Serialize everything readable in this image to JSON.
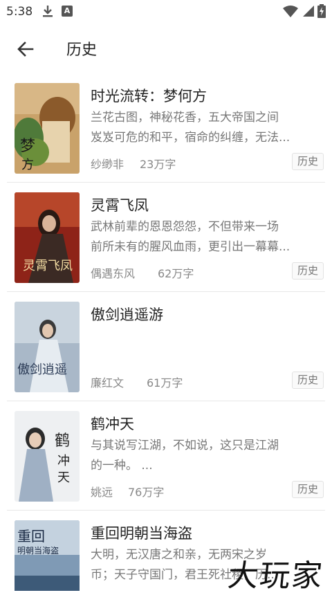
{
  "status": {
    "time": "5:38",
    "a_badge": "A"
  },
  "appbar": {
    "title": "历史"
  },
  "books": [
    {
      "title": "时光流转：梦何方",
      "desc": [
        "兰花古图，神秘花香，五大帝国之间",
        "岌岌可危的和平，宿命的纠缠，无法..."
      ],
      "author": "纱缈非",
      "words": "23万字",
      "tag": "历史"
    },
    {
      "title": "灵霄飞凤",
      "desc": [
        "武林前辈的恩恩怨怨，不但带来一场",
        "前所未有的腥风血雨，更引出一幕幕..."
      ],
      "author": "偶遇东风",
      "words": "62万字",
      "tag": "历史"
    },
    {
      "title": "傲剑逍遥游",
      "desc": [
        "",
        ""
      ],
      "author": "廉红文",
      "words": "61万字",
      "tag": "历史"
    },
    {
      "title": "鹤冲天",
      "desc": [
        "与其说写江湖，不如说，这只是江湖",
        "的一种。 ..."
      ],
      "author": "姚远",
      "words": "76万字",
      "tag": "历史"
    },
    {
      "title": "重回明朝当海盗",
      "desc": [
        "大明，无汉唐之和亲，无两宋之岁",
        "币；天子守国门，君王死社稷，历..."
      ],
      "author": "",
      "words": "",
      "tag": ""
    }
  ],
  "watermark": "大玩家"
}
